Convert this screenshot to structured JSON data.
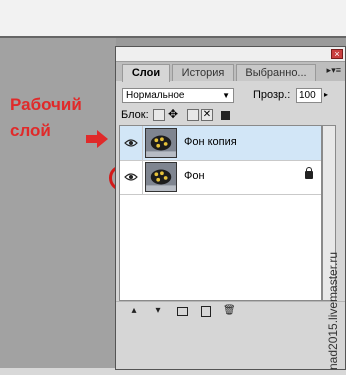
{
  "annotation": {
    "line1": "Рабочий",
    "line2": "слой"
  },
  "panel": {
    "tabs": [
      "Слои",
      "История",
      "Выбранно..."
    ],
    "blend_mode": "Нормальное",
    "opacity_label": "Прозр.:",
    "opacity_value": "100",
    "lock_label": "Блок:"
  },
  "layers": [
    {
      "name": "Фон копия",
      "selected": true
    },
    {
      "name": "Фон",
      "selected": false
    }
  ],
  "watermark": "nad2015.livemaster.ru",
  "colors": {
    "accent_red": "#e02a2a",
    "selected_row": "#d2e6f7"
  }
}
